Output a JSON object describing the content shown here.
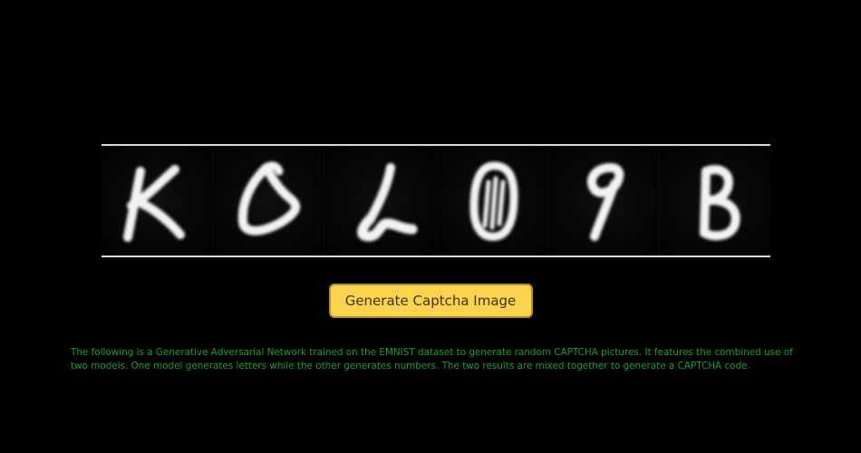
{
  "captcha": {
    "characters": [
      "K",
      "δ",
      "L",
      "0",
      "9",
      "B"
    ],
    "glyph_color": "#f2f2f2",
    "background_color": "#000000"
  },
  "generate_button": {
    "label": "Generate Captcha Image",
    "background_color": "#fcd34d"
  },
  "description": {
    "text": "The following is a Generative Adversarial Network trained on the EMNIST dataset to generate random CAPTCHA pictures. It features the combined use of two models. One model generates letters while the other generates numbers. The two results are mixed together to generate a CAPTCHA code.",
    "color": "#15a02a"
  }
}
